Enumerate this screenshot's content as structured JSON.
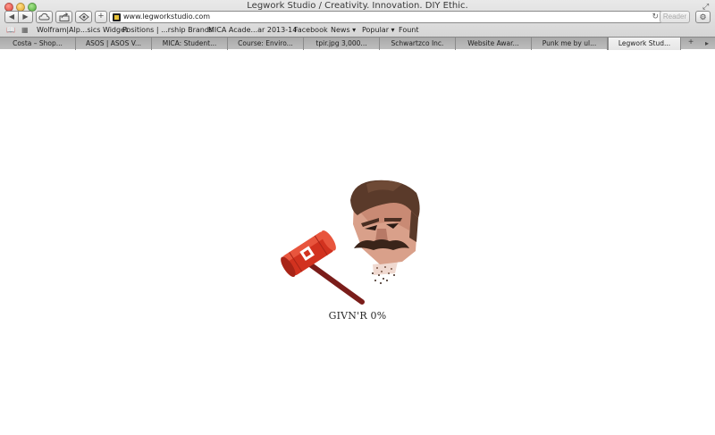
{
  "window": {
    "title": "Legwork Studio / Creativity. Innovation. DIY Ethic."
  },
  "toolbar": {
    "url": "www.legworkstudio.com",
    "reader_label": "Reader"
  },
  "bookmarks": [
    "Wolfram|Alp...sics Widget",
    "Positions | ...rship Brands",
    "MICA Acade...ar 2013-14",
    "Facebook",
    "News",
    "Popular",
    "Fount"
  ],
  "tabs": [
    "Costa – Shop...",
    "ASOS | ASOS V...",
    "MICA: Student...",
    "Course: Enviro...",
    "tpir.jpg 3,000...",
    "Schwartzco Inc.",
    "Website Awar...",
    "Punk me by ul...",
    "Legwork Stud..."
  ],
  "page": {
    "loading_label": "GIVN'R",
    "progress": "0%"
  },
  "colors": {
    "hammer_red": "#d2321f",
    "hammer_handle": "#7a1d1a",
    "hair_brown": "#5a3a2a",
    "skin": "#d9a08a"
  },
  "icons": {
    "back": "chevron-left-icon",
    "forward": "chevron-right-icon",
    "cloud": "cloud-icon",
    "share": "share-icon",
    "reading_list": "reading-list-icon",
    "add": "plus-icon",
    "reload": "reload-icon",
    "settings": "gear-icon",
    "bookmarks_book": "book-icon",
    "top_sites": "grid-icon"
  }
}
